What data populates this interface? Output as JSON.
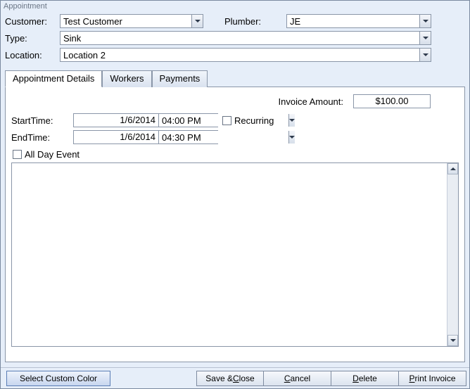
{
  "window": {
    "title": "Appointment"
  },
  "form": {
    "customer_label": "Customer:",
    "customer_value": "Test Customer",
    "plumber_label": "Plumber:",
    "plumber_value": "JE",
    "type_label": "Type:",
    "type_value": "Sink",
    "location_label": "Location:",
    "location_value": "Location 2"
  },
  "tabs": {
    "appointment_details": "Appointment Details",
    "workers": "Workers",
    "payments": "Payments",
    "active_index": 0
  },
  "details": {
    "invoice_label": "Invoice Amount:",
    "invoice_value": "$100.00",
    "start_label": "StartTime:",
    "start_date": "1/6/2014",
    "start_time": "04:00 PM",
    "end_label": "EndTime:",
    "end_date": "1/6/2014",
    "end_time": "04:30 PM",
    "recurring_label": "Recurring",
    "recurring_checked": false,
    "allday_label": "All Day Event",
    "allday_checked": false,
    "notes": ""
  },
  "buttons": {
    "select_color": "Select Custom Color",
    "save_close_pre": "Save & ",
    "save_close_m": "C",
    "save_close_post": "lose",
    "cancel_m": "C",
    "cancel_post": "ancel",
    "delete_m": "D",
    "delete_post": "elete",
    "print_m": "P",
    "print_post": "rint Invoice"
  }
}
